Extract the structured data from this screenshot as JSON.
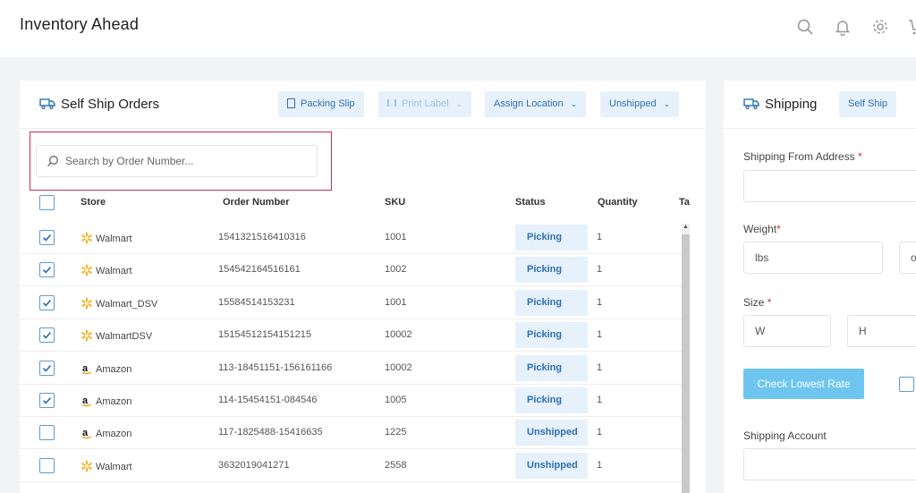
{
  "app": {
    "title": "Inventory Ahead"
  },
  "topbar": {
    "icons": [
      "search-icon",
      "bell-icon",
      "gear-icon",
      "cart-icon"
    ]
  },
  "orders": {
    "title": "Self Ship Orders",
    "toolbar": {
      "packing_slip": "Packing Slip",
      "print_label": "Print Label",
      "assign_location": "Assign Location",
      "unshipped": "Unshipped"
    },
    "search": {
      "placeholder": "Search by Order Number..."
    },
    "columns": [
      "Store",
      "Order Number",
      "SKU",
      "Status",
      "Quantity",
      "Ta"
    ],
    "rows": [
      {
        "store": "Walmart",
        "logo": "walmart",
        "order": "1541321516410316",
        "sku": "1001",
        "status": "Picking",
        "qty": "1",
        "checked": true
      },
      {
        "store": "Walmart",
        "logo": "walmart",
        "order": "154542164516161",
        "sku": "1002",
        "status": "Picking",
        "qty": "1",
        "checked": true
      },
      {
        "store": "Walmart_DSV",
        "logo": "walmart",
        "order": "15584514153231",
        "sku": "1001",
        "status": "Picking",
        "qty": "1",
        "checked": true
      },
      {
        "store": "WalmartDSV",
        "logo": "walmart",
        "order": "15154512154151215",
        "sku": "10002",
        "status": "Picking",
        "qty": "1",
        "checked": true
      },
      {
        "store": "Amazon",
        "logo": "amazon",
        "order": "113-18451151-156161166",
        "sku": "10002",
        "status": "Picking",
        "qty": "1",
        "checked": true
      },
      {
        "store": "Amazon",
        "logo": "amazon",
        "order": "114-15454151-084546",
        "sku": "1005",
        "status": "Picking",
        "qty": "1",
        "checked": true
      },
      {
        "store": "Amazon",
        "logo": "amazon",
        "order": "117-1825488-15416635",
        "sku": "1225",
        "status": "Unshipped",
        "qty": "1",
        "checked": false
      },
      {
        "store": "Walmart",
        "logo": "walmart",
        "order": "3632019041271",
        "sku": "2558",
        "status": "Unshipped",
        "qty": "1",
        "checked": false
      }
    ]
  },
  "shipping": {
    "title": "Shipping",
    "tab": "Self Ship",
    "from_label": "Shipping From Address",
    "weight_label": "Weight",
    "weight_unit": "lbs",
    "weight_unit2": "o",
    "size_label": "Size",
    "size_w": "W",
    "size_h": "H",
    "check_rate": "Check Lowest Rate",
    "account_label": "Shipping Account",
    "required_mark": "*"
  },
  "colors": {
    "accent": "#2e6fb1",
    "chip_bg": "#e7f1fb",
    "button": "#6ec6f0",
    "highlight": "#c9304a"
  }
}
